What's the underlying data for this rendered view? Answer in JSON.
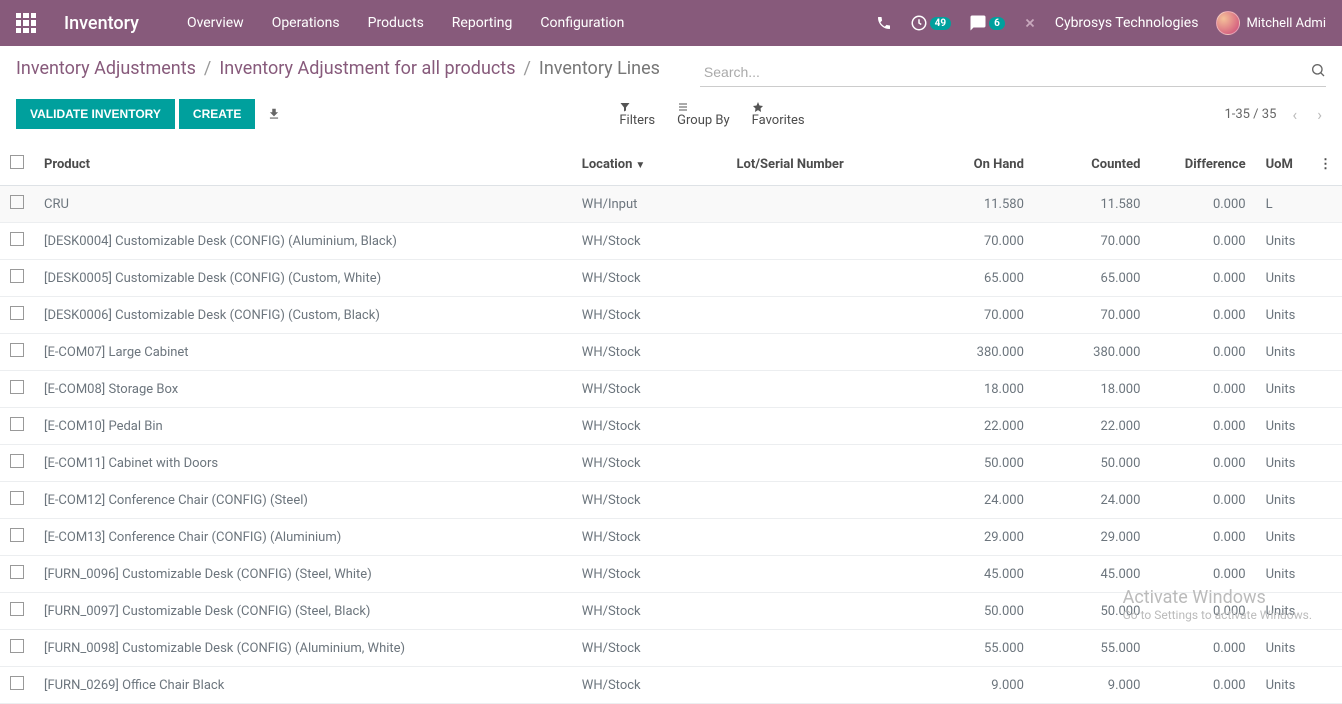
{
  "topbar": {
    "brand": "Inventory",
    "nav": [
      "Overview",
      "Operations",
      "Products",
      "Reporting",
      "Configuration"
    ],
    "activity_badge": "49",
    "discuss_badge": "6",
    "company": "Cybrosys Technologies",
    "user": "Mitchell Admi"
  },
  "breadcrumb": {
    "items": [
      "Inventory Adjustments",
      "Inventory Adjustment for all products"
    ],
    "current": "Inventory Lines"
  },
  "search": {
    "placeholder": "Search..."
  },
  "buttons": {
    "validate": "VALIDATE INVENTORY",
    "create": "CREATE"
  },
  "filters": {
    "filters": "Filters",
    "groupby": "Group By",
    "favorites": "Favorites"
  },
  "pager": {
    "range": "1-35 / 35"
  },
  "columns": {
    "product": "Product",
    "location": "Location",
    "lot": "Lot/Serial Number",
    "onhand": "On Hand",
    "counted": "Counted",
    "difference": "Difference",
    "uom": "UoM"
  },
  "rows": [
    {
      "product": "CRU",
      "location": "WH/Input",
      "lot": "",
      "onhand": "11.580",
      "counted": "11.580",
      "diff": "0.000",
      "uom": "L"
    },
    {
      "product": "[DESK0004] Customizable Desk (CONFIG) (Aluminium, Black)",
      "location": "WH/Stock",
      "lot": "",
      "onhand": "70.000",
      "counted": "70.000",
      "diff": "0.000",
      "uom": "Units"
    },
    {
      "product": "[DESK0005] Customizable Desk (CONFIG) (Custom, White)",
      "location": "WH/Stock",
      "lot": "",
      "onhand": "65.000",
      "counted": "65.000",
      "diff": "0.000",
      "uom": "Units"
    },
    {
      "product": "[DESK0006] Customizable Desk (CONFIG) (Custom, Black)",
      "location": "WH/Stock",
      "lot": "",
      "onhand": "70.000",
      "counted": "70.000",
      "diff": "0.000",
      "uom": "Units"
    },
    {
      "product": "[E-COM07] Large Cabinet",
      "location": "WH/Stock",
      "lot": "",
      "onhand": "380.000",
      "counted": "380.000",
      "diff": "0.000",
      "uom": "Units"
    },
    {
      "product": "[E-COM08] Storage Box",
      "location": "WH/Stock",
      "lot": "",
      "onhand": "18.000",
      "counted": "18.000",
      "diff": "0.000",
      "uom": "Units"
    },
    {
      "product": "[E-COM10] Pedal Bin",
      "location": "WH/Stock",
      "lot": "",
      "onhand": "22.000",
      "counted": "22.000",
      "diff": "0.000",
      "uom": "Units"
    },
    {
      "product": "[E-COM11] Cabinet with Doors",
      "location": "WH/Stock",
      "lot": "",
      "onhand": "50.000",
      "counted": "50.000",
      "diff": "0.000",
      "uom": "Units"
    },
    {
      "product": "[E-COM12] Conference Chair (CONFIG) (Steel)",
      "location": "WH/Stock",
      "lot": "",
      "onhand": "24.000",
      "counted": "24.000",
      "diff": "0.000",
      "uom": "Units"
    },
    {
      "product": "[E-COM13] Conference Chair (CONFIG) (Aluminium)",
      "location": "WH/Stock",
      "lot": "",
      "onhand": "29.000",
      "counted": "29.000",
      "diff": "0.000",
      "uom": "Units"
    },
    {
      "product": "[FURN_0096] Customizable Desk (CONFIG) (Steel, White)",
      "location": "WH/Stock",
      "lot": "",
      "onhand": "45.000",
      "counted": "45.000",
      "diff": "0.000",
      "uom": "Units"
    },
    {
      "product": "[FURN_0097] Customizable Desk (CONFIG) (Steel, Black)",
      "location": "WH/Stock",
      "lot": "",
      "onhand": "50.000",
      "counted": "50.000",
      "diff": "0.000",
      "uom": "Units"
    },
    {
      "product": "[FURN_0098] Customizable Desk (CONFIG) (Aluminium, White)",
      "location": "WH/Stock",
      "lot": "",
      "onhand": "55.000",
      "counted": "55.000",
      "diff": "0.000",
      "uom": "Units"
    },
    {
      "product": "[FURN_0269] Office Chair Black",
      "location": "WH/Stock",
      "lot": "",
      "onhand": "9.000",
      "counted": "9.000",
      "diff": "0.000",
      "uom": "Units"
    }
  ],
  "watermark": {
    "title": "Activate Windows",
    "sub": "Go to Settings to activate Windows."
  }
}
